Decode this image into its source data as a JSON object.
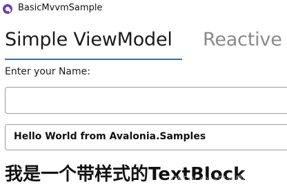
{
  "window": {
    "title": "BasicMvvmSample",
    "icon": "avalonia-logo-icon"
  },
  "tabs": [
    {
      "label": "Simple ViewModel",
      "selected": true
    },
    {
      "label": "Reactive",
      "selected": false
    }
  ],
  "form": {
    "name_label": "Enter your Name:",
    "name_value": "",
    "greeting": "Hello World from Avalonia.Samples"
  },
  "styled_textblock": "我是一个带样式的TextBlock",
  "watermark": "CSDN @一只麦兜的小小IT技术",
  "colors": {
    "tab_underline": "#1976d2",
    "tab_inactive": "#8a8a8a",
    "border": "#9a9a9a"
  }
}
